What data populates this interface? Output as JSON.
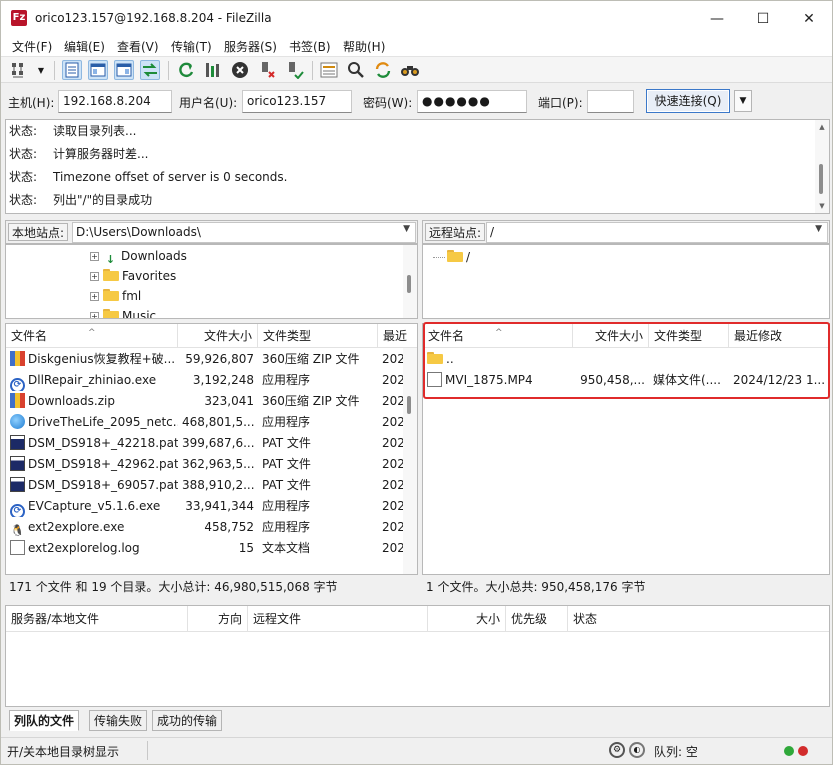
{
  "window": {
    "title": "orico123.157@192.168.8.204 - FileZilla",
    "app_icon_text": "Fz",
    "controls": [
      "—",
      "☐",
      "✕"
    ]
  },
  "menu": [
    "文件(F)",
    "编辑(E)",
    "查看(V)",
    "传输(T)",
    "服务器(S)",
    "书签(B)",
    "帮助(H)"
  ],
  "quickconnect": {
    "host_label": "主机(H):",
    "host_value": "192.168.8.204",
    "user_label": "用户名(U):",
    "user_value": "orico123.157",
    "password_label": "密码(W):",
    "password_value": "●●●●●●",
    "port_label": "端口(P):",
    "port_value": "",
    "connect_label": "快速连接(Q)"
  },
  "log": [
    {
      "key": "状态:",
      "text": "读取目录列表..."
    },
    {
      "key": "状态:",
      "text": "计算服务器时差..."
    },
    {
      "key": "状态:",
      "text": "Timezone offset of server is 0 seconds."
    },
    {
      "key": "状态:",
      "text": "列出\"/\"的目录成功"
    }
  ],
  "local": {
    "site_label": "本地站点:",
    "path": "D:\\Users\\Downloads\\",
    "tree": [
      "Downloads",
      "Favorites",
      "fml",
      "Music"
    ],
    "columns": [
      "文件名",
      "文件大小",
      "文件类型",
      "最近"
    ],
    "files": [
      {
        "name": "Diskgenius恢复教程+破...",
        "size": "59,926,807",
        "type": "360压缩 ZIP 文件",
        "date": "202",
        "icon": "zip"
      },
      {
        "name": "DllRepair_zhiniao.exe",
        "size": "3,192,248",
        "type": "应用程序",
        "date": "202",
        "icon": "app"
      },
      {
        "name": "Downloads.zip",
        "size": "323,041",
        "type": "360压缩 ZIP 文件",
        "date": "202",
        "icon": "zip"
      },
      {
        "name": "DriveTheLife_2095_netc...",
        "size": "468,801,5...",
        "type": "应用程序",
        "date": "202",
        "icon": "ball"
      },
      {
        "name": "DSM_DS918+_42218.pat",
        "size": "399,687,6...",
        "type": "PAT 文件",
        "date": "202",
        "icon": "pat"
      },
      {
        "name": "DSM_DS918+_42962.pat",
        "size": "362,963,5...",
        "type": "PAT 文件",
        "date": "202",
        "icon": "pat"
      },
      {
        "name": "DSM_DS918+_69057.pat",
        "size": "388,910,2...",
        "type": "PAT 文件",
        "date": "202",
        "icon": "pat"
      },
      {
        "name": "EVCapture_v5.1.6.exe",
        "size": "33,941,344",
        "type": "应用程序",
        "date": "202",
        "icon": "app"
      },
      {
        "name": "ext2explore.exe",
        "size": "458,752",
        "type": "应用程序",
        "date": "202",
        "icon": "tux"
      },
      {
        "name": "ext2explorelog.log",
        "size": "15",
        "type": "文本文档",
        "date": "202",
        "icon": "doc"
      }
    ],
    "status": "171 个文件 和 19 个目录。大小总计: 46,980,515,068 字节"
  },
  "remote": {
    "site_label": "远程站点:",
    "path": "/",
    "tree": [
      "/"
    ],
    "columns": [
      "文件名",
      "文件大小",
      "文件类型",
      "最近修改"
    ],
    "files": [
      {
        "name": "..",
        "size": "",
        "type": "",
        "date": "",
        "icon": "folder"
      },
      {
        "name": "MVI_1875.MP4",
        "size": "950,458,...",
        "type": "媒体文件(....",
        "date": "2024/12/23 1...",
        "icon": "doc"
      }
    ],
    "status": "1 个文件。大小总共: 950,458,176 字节"
  },
  "queue": {
    "columns": [
      "服务器/本地文件",
      "方向",
      "远程文件",
      "大小",
      "优先级",
      "状态"
    ],
    "tabs": [
      "列队的文件",
      "传输失败",
      "成功的传输"
    ]
  },
  "statusbar": {
    "left": "开/关本地目录树显示",
    "queue": "队列: 空"
  },
  "colors": {
    "highlight_box": "#e02b2b",
    "active_toolbar": "#cde3f7"
  }
}
